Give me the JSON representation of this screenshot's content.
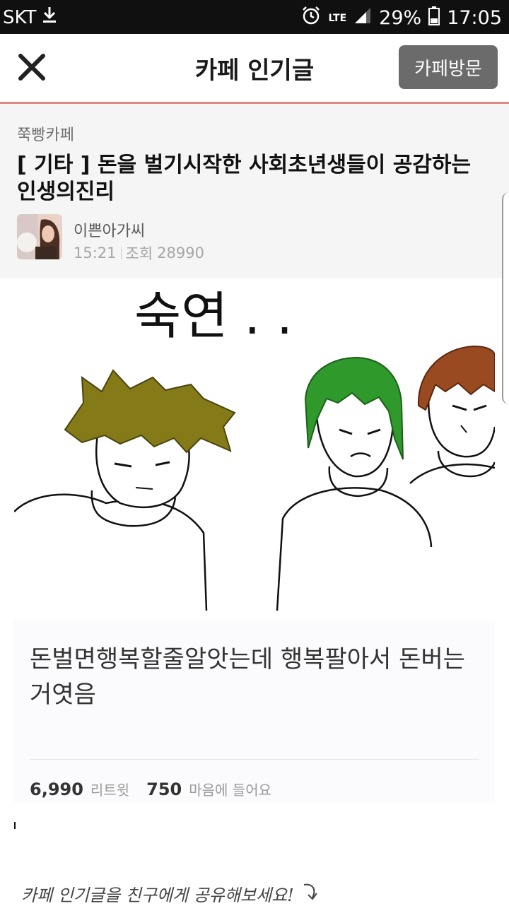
{
  "status_bar": {
    "carrier": "SKT",
    "network": "LTE",
    "battery": "29%",
    "time": "17:05",
    "icons": [
      "download-icon",
      "alarm-icon",
      "signal-icon",
      "battery-icon"
    ]
  },
  "app_bar": {
    "title": "카페 인기글",
    "visit_button": "카페방문",
    "close_icon": "close-icon"
  },
  "post": {
    "cafe_name": "쭉빵카페",
    "title": "[ 기타 ] 돈을 벌기시작한 사회초년생들이 공감하는 인생의진리",
    "author": "이쁜아가씨",
    "time": "15:21",
    "views_label": "조회",
    "views": "28990"
  },
  "comic": {
    "caption": "숙연 . ."
  },
  "tweet": {
    "text": "돈벌면행복할줄알앗는데 행복팔아서 돈버는거엿음",
    "retweet_count": "6,990",
    "retweet_label": "리트윗",
    "like_count": "750",
    "like_label": "마음에 들어요"
  },
  "footer": {
    "share_text": "카페 인기글을 친구에게 공유해보세요!"
  },
  "colors": {
    "status_bg": "#101010",
    "accent_line": "#e08a86",
    "visit_button_bg": "#6b6b6b",
    "header_bg": "#f5f5f5"
  }
}
